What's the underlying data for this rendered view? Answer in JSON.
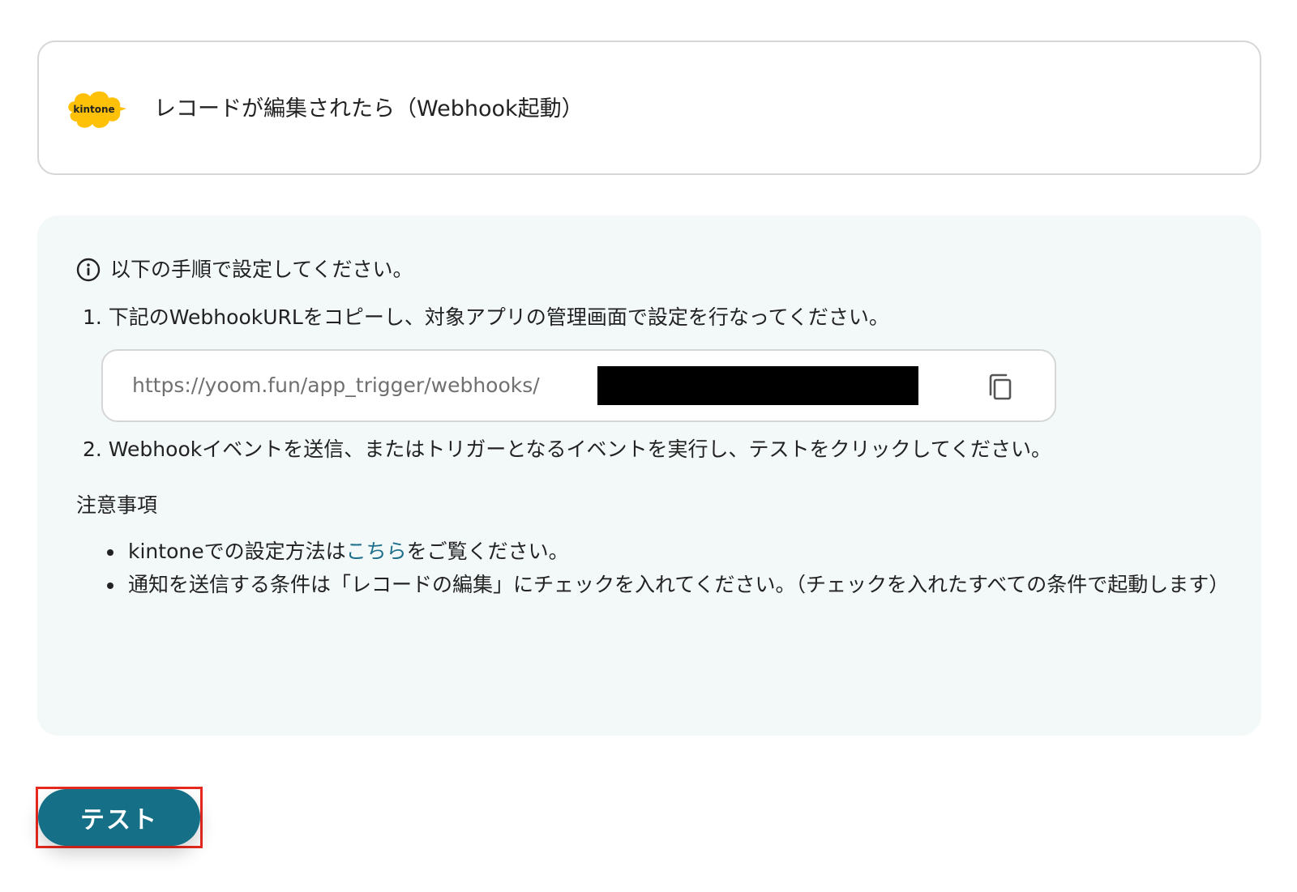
{
  "trigger": {
    "app_logo_text": "kintone",
    "title": "レコードが編集されたら（Webhook起動）",
    "logo_color": "#ffc107"
  },
  "instructions": {
    "heading": "以下の手順で設定してください。",
    "step1": "1. 下記のWebhookURLをコピーし、対象アプリの管理画面で設定を行なってください。",
    "webhook_url": "https://yoom.fun/app_trigger/webhooks/",
    "step2": "2. Webhookイベントを送信、またはトリガーとなるイベントを実行し、テストをクリックしてください。",
    "copy_icon": "copy-icon",
    "info_icon": "info-icon"
  },
  "notes": {
    "title": "注意事項",
    "item1_before": "kintoneでの設定方法は",
    "item1_link": "こちら",
    "item1_after": "をご覧ください。",
    "item2": "通知を送信する条件は「レコードの編集」にチェックを入れてください。（チェックを入れたすべての条件で起動します）"
  },
  "actions": {
    "test_label": "テスト"
  },
  "colors": {
    "accent": "#146f87",
    "link": "#1d6f8c",
    "panel_bg": "#f3f8f8",
    "highlight": "#e8291f"
  }
}
